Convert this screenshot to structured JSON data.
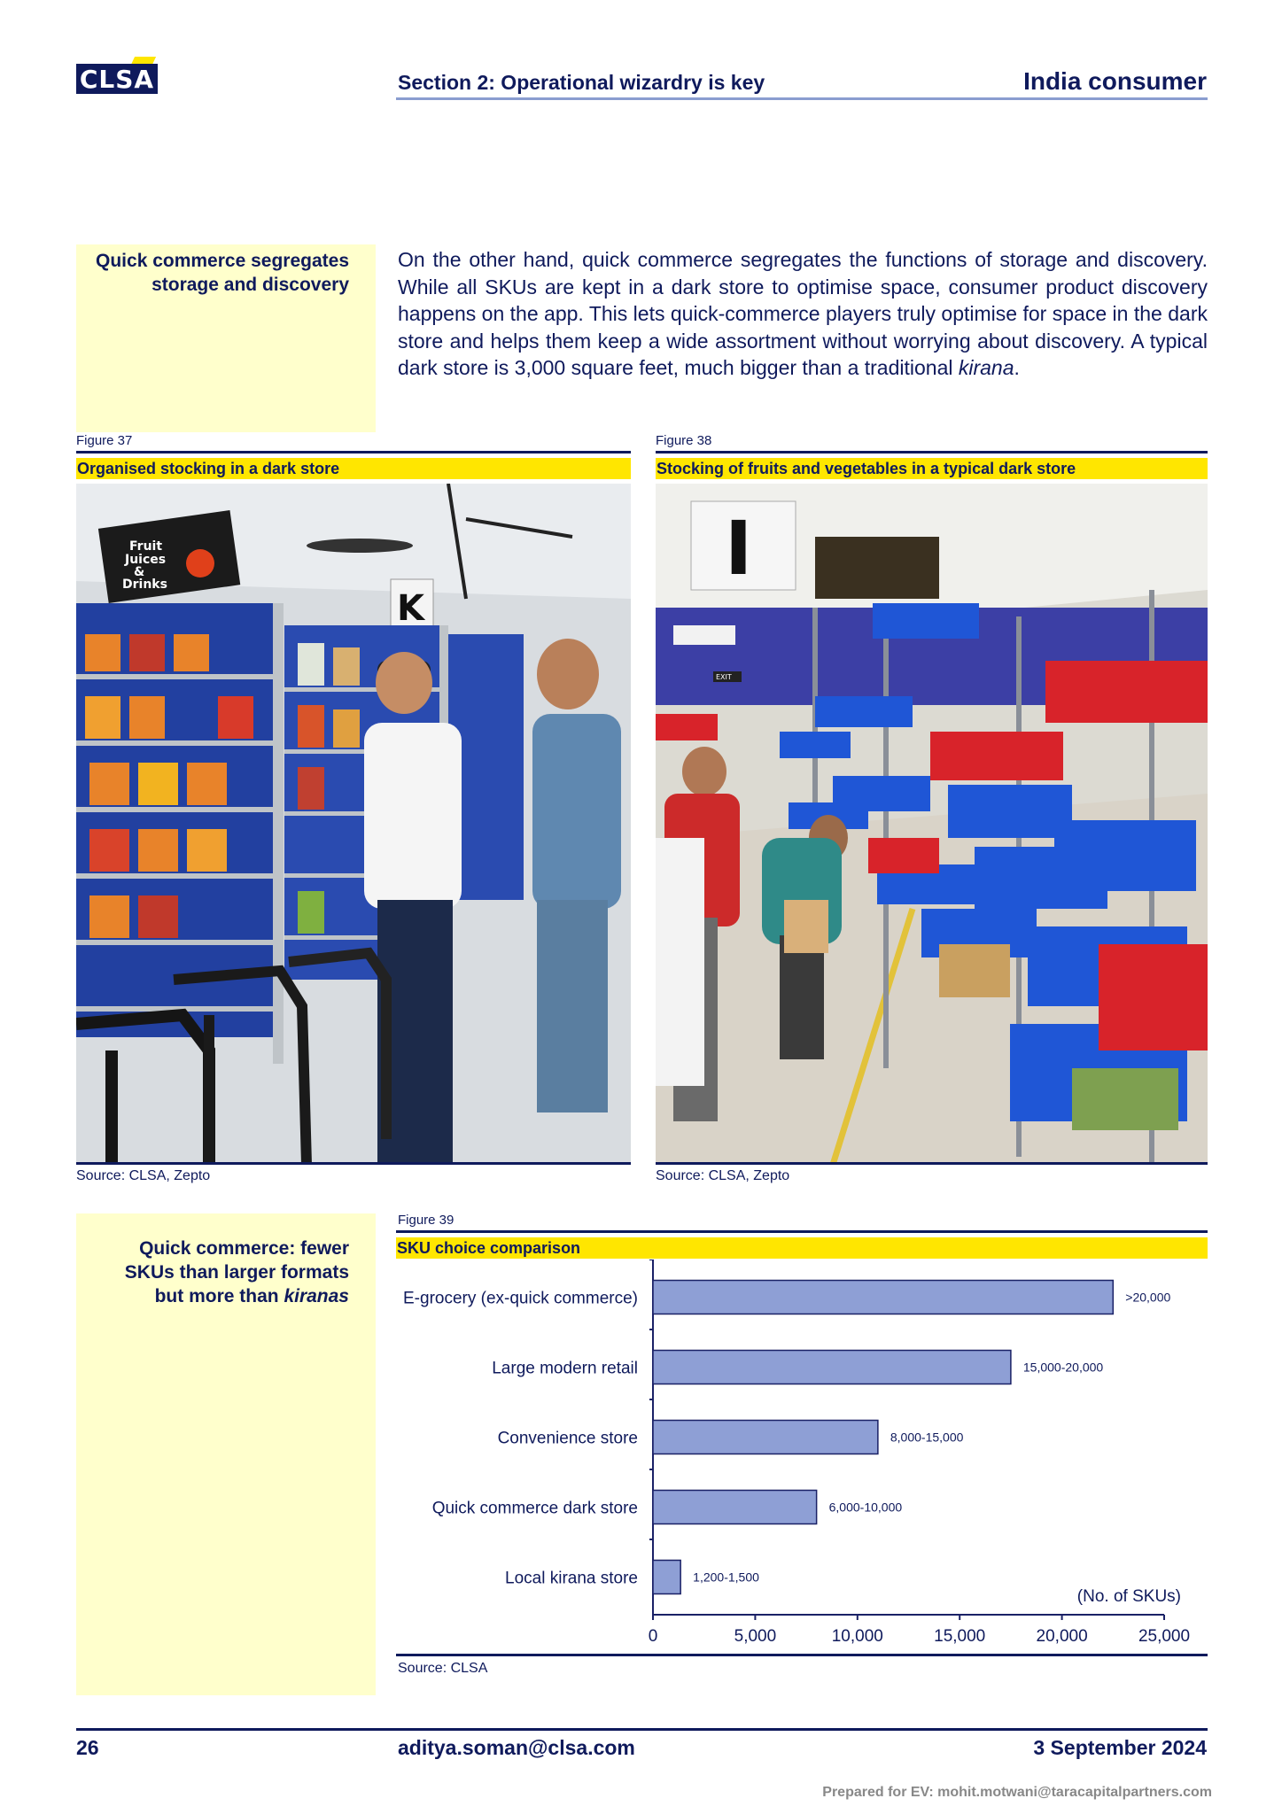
{
  "header": {
    "logo_text": "CLSA",
    "section_title": "Section 2: Operational wizardry is key",
    "report_title": "India consumer"
  },
  "sidebar_1": {
    "line1": "Quick commerce segregates",
    "line2": "storage and discovery"
  },
  "body_paragraph": {
    "text_main": "On the other hand, quick commerce segregates the functions of storage and discovery. While all SKUs are kept in a dark store to optimise space, consumer product discovery happens on the app. This lets quick-commerce players truly optimise for space in the dark store and helps them keep a wide assortment without worrying about discovery. A typical dark store is 3,000 square feet, much bigger than a traditional ",
    "text_italic": "kirana",
    "text_end": "."
  },
  "figure37": {
    "label": "Figure 37",
    "title": "Organised stocking in a dark store",
    "source": "Source: CLSA, Zepto",
    "sign_line1": "Fruit",
    "sign_line2": "Juices",
    "sign_line3": "&",
    "sign_line4": "Drinks",
    "aisle_letter": "K"
  },
  "figure38": {
    "label": "Figure 38",
    "title": "Stocking of fruits and vegetables in a typical dark store",
    "source": "Source: CLSA, Zepto",
    "aisle_letter": "I",
    "exit_sign": "EXIT"
  },
  "sidebar_2": {
    "line1": "Quick commerce: fewer",
    "line2": "SKUs than larger formats",
    "line3_prefix": "but more than ",
    "line3_italic": "kiranas"
  },
  "figure39": {
    "label": "Figure 39",
    "title": "SKU choice comparison",
    "source": "Source: CLSA",
    "unit_note": "(No. of SKUs)"
  },
  "chart_data": {
    "type": "bar",
    "orientation": "horizontal",
    "title": "SKU choice comparison",
    "categories": [
      "E-grocery (ex-quick commerce)",
      "Large modern retail",
      "Convenience store",
      "Quick commerce dark store",
      "Local kirana store"
    ],
    "values": [
      22500,
      17500,
      11000,
      8000,
      1350
    ],
    "data_labels": [
      ">20,000",
      "15,000-20,000",
      "8,000-15,000",
      "6,000-10,000",
      "1,200-1,500"
    ],
    "xlim": [
      0,
      25000
    ],
    "xticks": [
      0,
      5000,
      10000,
      15000,
      20000,
      25000
    ],
    "xtick_labels": [
      "0",
      "5,000",
      "10,000",
      "15,000",
      "20,000",
      "25,000"
    ],
    "bar_color": "#8e9fd5",
    "bar_edge_color": "#1a2166",
    "grid": false
  },
  "footer": {
    "page_number": "26",
    "email": "aditya.soman@clsa.com",
    "date": "3 September 2024",
    "prepared_for": "Prepared for EV: mohit.motwani@taracapitalpartners.com"
  }
}
